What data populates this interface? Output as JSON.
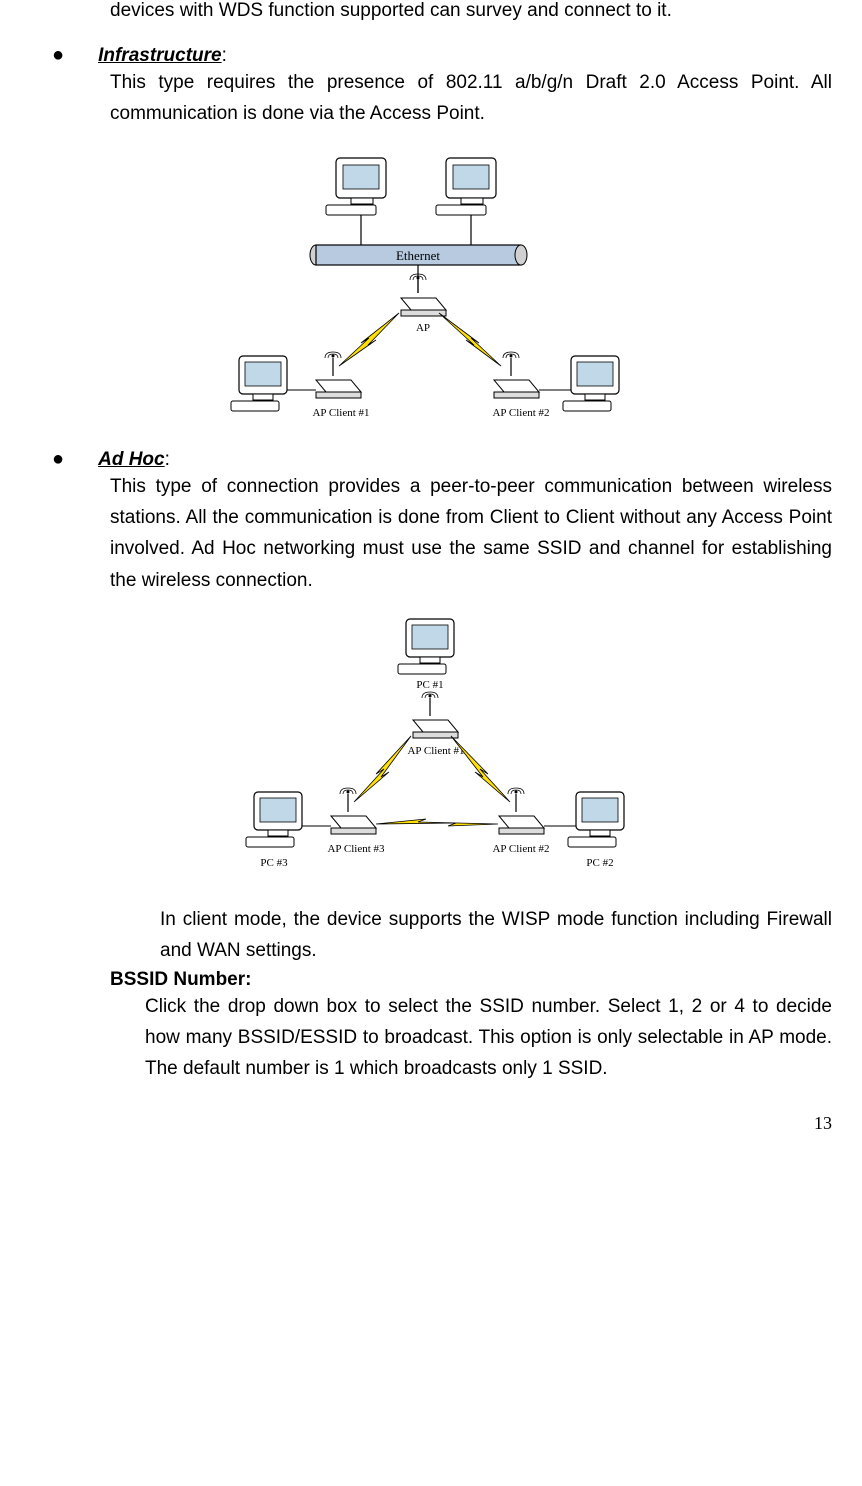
{
  "top_line": "devices with WDS function supported can survey and connect to it.",
  "sections": {
    "infrastructure": {
      "title": "Infrastructure",
      "body": "This type requires the presence of 802.11 a/b/g/n Draft 2.0 Access Point. All communication is done via the Access Point."
    },
    "adhoc": {
      "title": "Ad Hoc",
      "body": "This type of connection provides a peer-to-peer communication between wireless stations. All the communication is done from Client to Client without any Access Point involved. Ad Hoc networking must use the same SSID and channel for establishing the wireless connection.",
      "sub_body": "In client mode, the device supports the WISP mode function including Firewall and WAN settings."
    },
    "bssid": {
      "title": "BSSID Number:",
      "body": "Click the drop down box to select the SSID number. Select 1, 2 or 4 to decide how many BSSID/ESSID to broadcast. This option is only selectable in AP mode. The default number is 1 which broadcasts only 1 SSID."
    }
  },
  "diagram1": {
    "ethernet": "Ethernet",
    "ap": "AP",
    "client1": "AP Client #1",
    "client2": "AP Client #2"
  },
  "diagram2": {
    "pc1": "PC #1",
    "pc2": "PC #2",
    "pc3": "PC #3",
    "client1": "AP Client #1",
    "client2": "AP Client #2",
    "client3": "AP Client #3"
  },
  "page_number": "13"
}
